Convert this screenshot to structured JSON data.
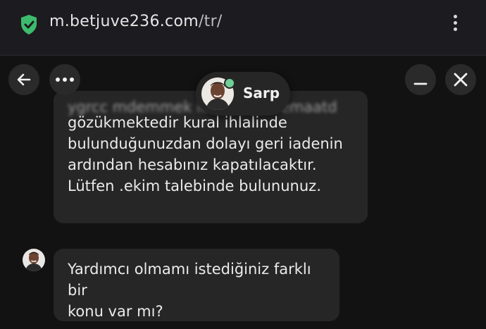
{
  "browser": {
    "url_host": "m.betjuve236.com",
    "url_path": "/tr/",
    "security_icon": "shield-check-icon",
    "menu_icon": "kebab-menu-icon"
  },
  "chat_header": {
    "back_icon": "arrow-left-icon",
    "more_icon": "ellipsis-icon",
    "minimize_icon": "minimize-icon",
    "close_icon": "close-icon",
    "agent_name": "Sarp",
    "agent_status_color": "#6fcf97"
  },
  "messages": [
    {
      "lines": [
        "gözükmektedir kural ihlalinde",
        "bulunduğunuzdan dolayı geri iadenin",
        "ardından hesabınız kapatılacaktır.",
        "Lütfen .ekim talebinde bulununuz."
      ]
    },
    {
      "lines": [
        "Yardımcı olmamı istediğiniz farklı bir",
        "konu var mı?"
      ]
    }
  ]
}
